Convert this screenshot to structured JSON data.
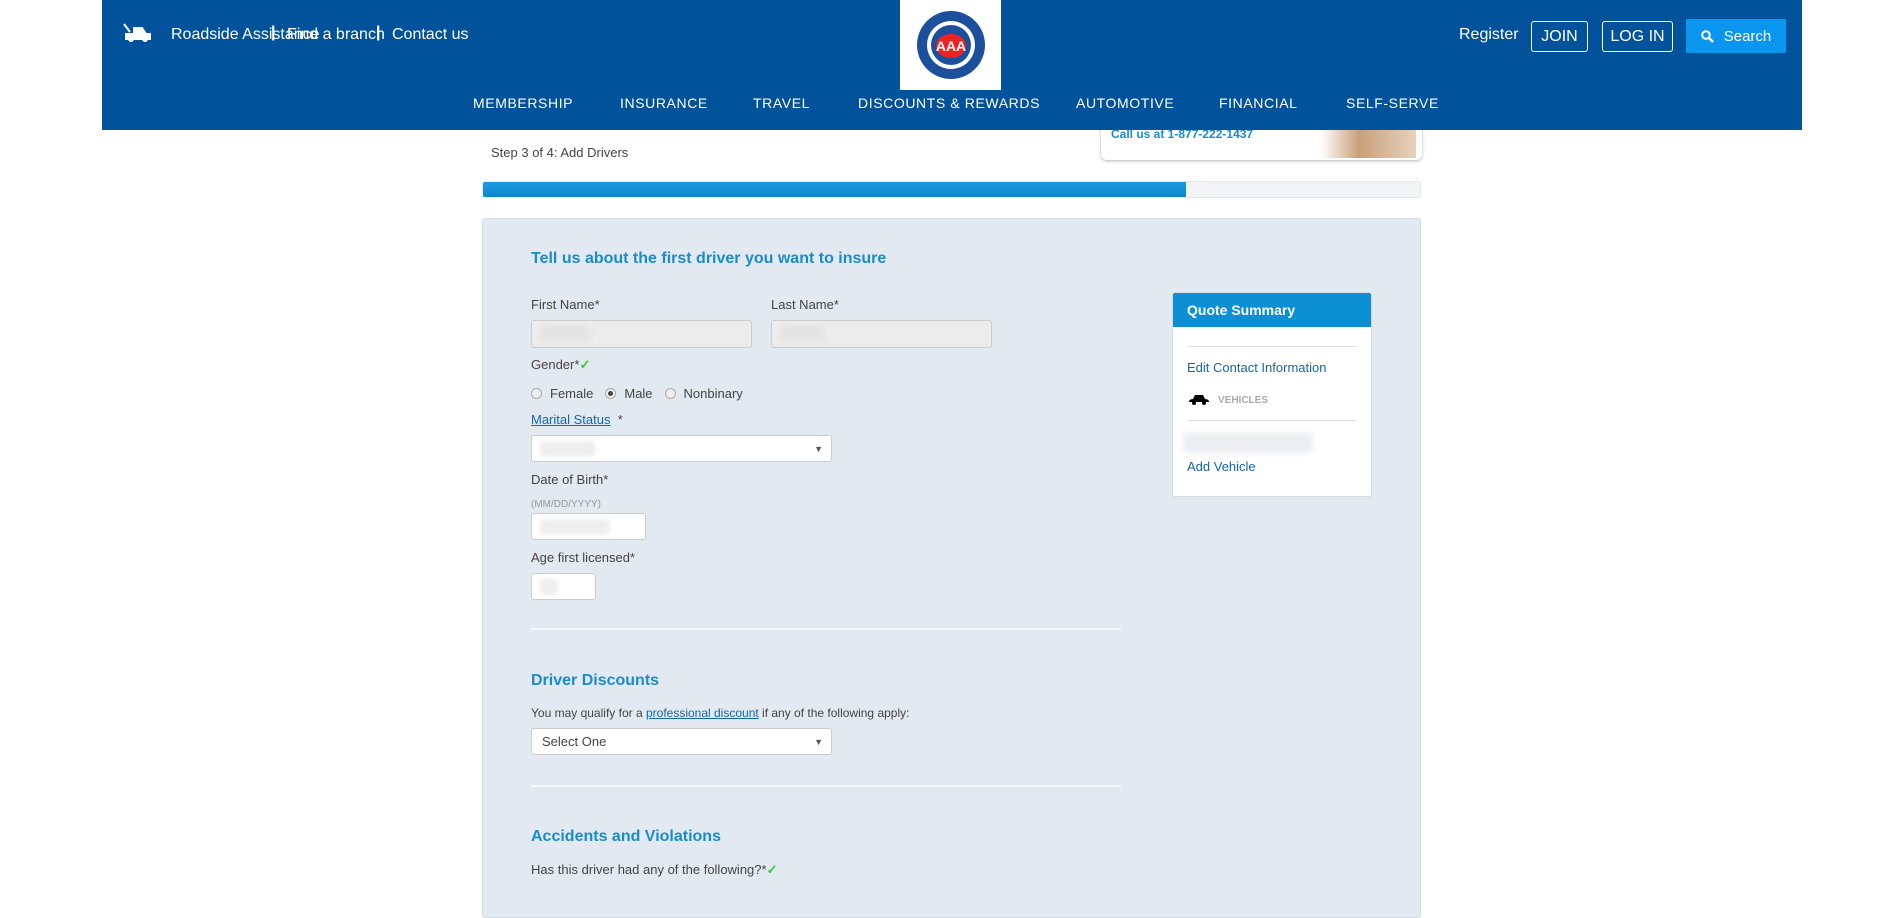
{
  "header": {
    "utility_links": [
      "Roadside Assistance",
      "Find a branch",
      "Contact us"
    ],
    "register": "Register",
    "join": "JOIN",
    "login": "LOG IN",
    "search": "Search",
    "logo_text": "AUTOMOBILE CLUB SOUTHERN CALIFORNIA AAA",
    "nav": [
      "MEMBERSHIP",
      "INSURANCE",
      "TRAVEL",
      "DISCOUNTS & REWARDS",
      "AUTOMOTIVE",
      "FINANCIAL",
      "SELF-SERVE"
    ]
  },
  "callout": {
    "phone": "Call us at 1-877-222-1437"
  },
  "step": "Step 3 of 4: Add Drivers",
  "progress_percent": 75,
  "form": {
    "title": "Tell us about the first driver you want to insure",
    "first_name": "First Name",
    "last_name": "Last Name",
    "required": "*",
    "gender": "Gender",
    "gender_options": [
      "Female",
      "Male",
      "Nonbinary"
    ],
    "gender_selected": "Male",
    "marital_status": "Marital Status",
    "dob": "Date of Birth",
    "dob_hint": "(MM/DD/YYYY)",
    "age_licensed": "Age first licensed"
  },
  "discounts": {
    "title": "Driver Discounts",
    "text_before": "You may qualify for a ",
    "link": "professional discount",
    "text_after": " if any of the following apply:",
    "select_value": "Select One"
  },
  "accidents": {
    "title": "Accidents and Violations",
    "question": "Has this driver had any of the following?"
  },
  "quote_summary": {
    "title": "Quote Summary",
    "edit_contact": "Edit Contact Information",
    "vehicles": "VEHICLES",
    "add_vehicle": "Add Vehicle"
  },
  "colors": {
    "header": "#00529b",
    "accent": "#1a8ccd",
    "search": "#0a96ee",
    "panel": "#e2e9f0"
  }
}
